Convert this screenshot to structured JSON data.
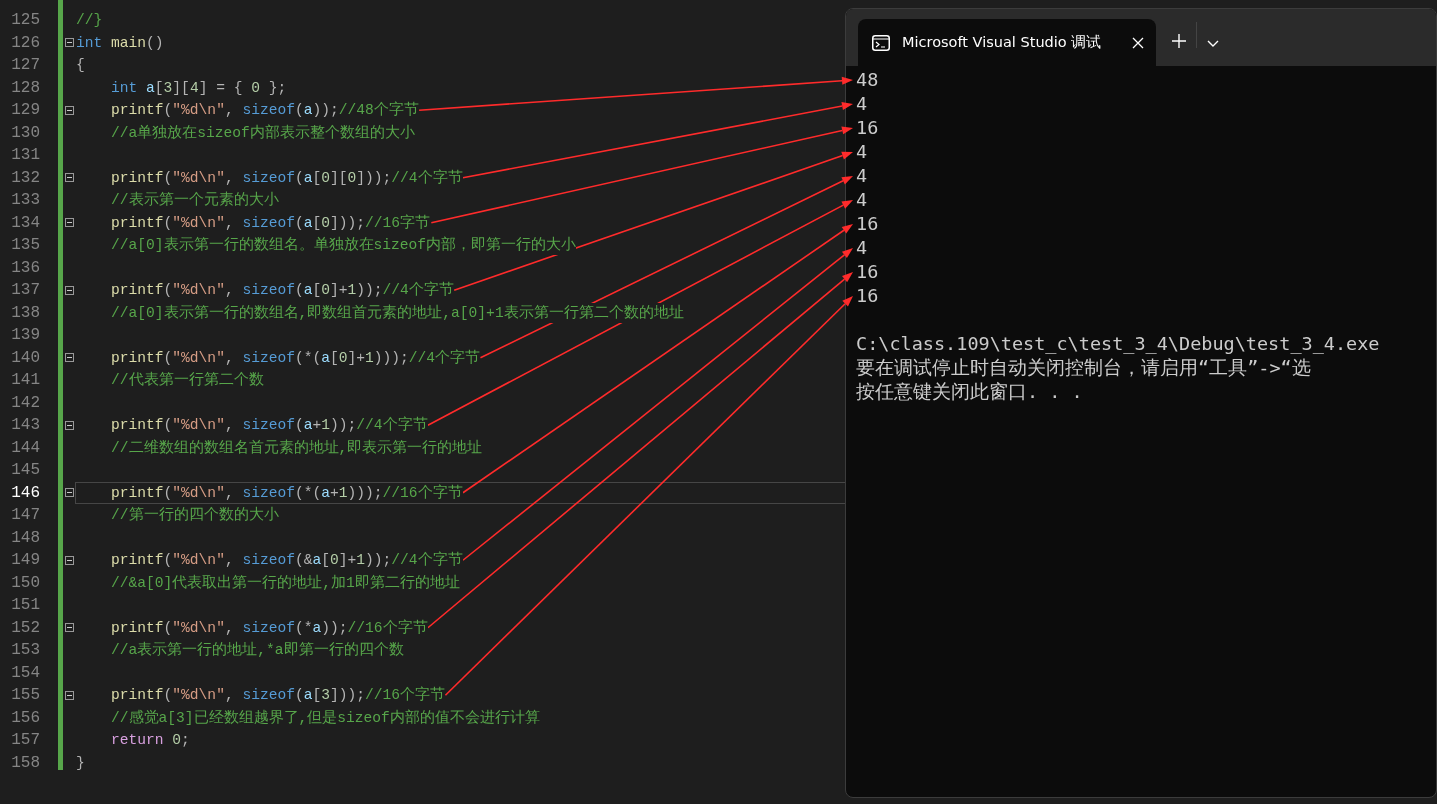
{
  "editor": {
    "lines": [
      {
        "number": "125",
        "fold": false,
        "current": false,
        "annotated": false,
        "tokens": [
          {
            "kind": "com",
            "text": "//}"
          }
        ]
      },
      {
        "number": "126",
        "fold": true,
        "current": false,
        "annotated": false,
        "tokens": [
          {
            "kind": "kw",
            "text": "int"
          },
          {
            "kind": "fn",
            "text": " main"
          },
          {
            "kind": "pun",
            "text": "()"
          }
        ]
      },
      {
        "number": "127",
        "fold": false,
        "current": false,
        "annotated": false,
        "tokens": [
          {
            "kind": "pun",
            "text": "{"
          }
        ]
      },
      {
        "number": "128",
        "fold": false,
        "current": false,
        "annotated": false,
        "tokens": [
          {
            "kind": "kw",
            "text": "    int"
          },
          {
            "kind": "id",
            "text": " a"
          },
          {
            "kind": "pun",
            "text": "["
          },
          {
            "kind": "num",
            "text": "3"
          },
          {
            "kind": "pun",
            "text": "]["
          },
          {
            "kind": "num",
            "text": "4"
          },
          {
            "kind": "pun",
            "text": "] = { "
          },
          {
            "kind": "num",
            "text": "0"
          },
          {
            "kind": "pun",
            "text": " };"
          }
        ]
      },
      {
        "number": "129",
        "fold": true,
        "current": false,
        "annotated": true,
        "tokens": [
          {
            "kind": "fn",
            "text": "    printf"
          },
          {
            "kind": "pun",
            "text": "("
          },
          {
            "kind": "str",
            "text": "\"%d\\n\""
          },
          {
            "kind": "pun",
            "text": ", "
          },
          {
            "kind": "kw",
            "text": "sizeof"
          },
          {
            "kind": "pun",
            "text": "("
          },
          {
            "kind": "id",
            "text": "a"
          },
          {
            "kind": "pun",
            "text": "));"
          },
          {
            "kind": "com",
            "text": "//48个字节"
          }
        ]
      },
      {
        "number": "130",
        "fold": false,
        "current": false,
        "annotated": false,
        "tokens": [
          {
            "kind": "com",
            "text": "    //a单独放在sizeof内部表示整个数组的大小"
          }
        ]
      },
      {
        "number": "131",
        "fold": false,
        "current": false
      },
      {
        "number": "132",
        "fold": true,
        "current": false,
        "annotated": true,
        "tokens": [
          {
            "kind": "fn",
            "text": "    printf"
          },
          {
            "kind": "pun",
            "text": "("
          },
          {
            "kind": "str",
            "text": "\"%d\\n\""
          },
          {
            "kind": "pun",
            "text": ", "
          },
          {
            "kind": "kw",
            "text": "sizeof"
          },
          {
            "kind": "pun",
            "text": "("
          },
          {
            "kind": "id",
            "text": "a"
          },
          {
            "kind": "pun",
            "text": "["
          },
          {
            "kind": "num",
            "text": "0"
          },
          {
            "kind": "pun",
            "text": "]["
          },
          {
            "kind": "num",
            "text": "0"
          },
          {
            "kind": "pun",
            "text": "]));"
          },
          {
            "kind": "com",
            "text": "//4个字节"
          }
        ]
      },
      {
        "number": "133",
        "fold": false,
        "current": false,
        "annotated": false,
        "tokens": [
          {
            "kind": "com",
            "text": "    //表示第一个元素的大小"
          }
        ]
      },
      {
        "number": "134",
        "fold": true,
        "current": false,
        "annotated": true,
        "tokens": [
          {
            "kind": "fn",
            "text": "    printf"
          },
          {
            "kind": "pun",
            "text": "("
          },
          {
            "kind": "str",
            "text": "\"%d\\n\""
          },
          {
            "kind": "pun",
            "text": ", "
          },
          {
            "kind": "kw",
            "text": "sizeof"
          },
          {
            "kind": "pun",
            "text": "("
          },
          {
            "kind": "id",
            "text": "a"
          },
          {
            "kind": "pun",
            "text": "["
          },
          {
            "kind": "num",
            "text": "0"
          },
          {
            "kind": "pun",
            "text": "]));"
          },
          {
            "kind": "com",
            "text": "//16字节"
          }
        ]
      },
      {
        "number": "135",
        "fold": false,
        "current": false,
        "annotated": false,
        "tokens": [
          {
            "kind": "com",
            "text": "    //a[0]表示第一行的数组名。单独放在sizeof内部，即第一行的大小"
          }
        ]
      },
      {
        "number": "136",
        "fold": false,
        "current": false
      },
      {
        "number": "137",
        "fold": true,
        "current": false,
        "annotated": true,
        "tokens": [
          {
            "kind": "fn",
            "text": "    printf"
          },
          {
            "kind": "pun",
            "text": "("
          },
          {
            "kind": "str",
            "text": "\"%d\\n\""
          },
          {
            "kind": "pun",
            "text": ", "
          },
          {
            "kind": "kw",
            "text": "sizeof"
          },
          {
            "kind": "pun",
            "text": "("
          },
          {
            "kind": "id",
            "text": "a"
          },
          {
            "kind": "pun",
            "text": "["
          },
          {
            "kind": "num",
            "text": "0"
          },
          {
            "kind": "pun",
            "text": "]+"
          },
          {
            "kind": "num",
            "text": "1"
          },
          {
            "kind": "pun",
            "text": "));"
          },
          {
            "kind": "com",
            "text": "//4个字节"
          }
        ]
      },
      {
        "number": "138",
        "fold": false,
        "current": false,
        "annotated": false,
        "tokens": [
          {
            "kind": "com",
            "text": "    //a[0]表示第一行的数组名,即数组首元素的地址,a[0]+1表示第一行第二个数的地址"
          }
        ]
      },
      {
        "number": "139",
        "fold": false,
        "current": false
      },
      {
        "number": "140",
        "fold": true,
        "current": false,
        "annotated": true,
        "tokens": [
          {
            "kind": "fn",
            "text": "    printf"
          },
          {
            "kind": "pun",
            "text": "("
          },
          {
            "kind": "str",
            "text": "\"%d\\n\""
          },
          {
            "kind": "pun",
            "text": ", "
          },
          {
            "kind": "kw",
            "text": "sizeof"
          },
          {
            "kind": "pun",
            "text": "(*("
          },
          {
            "kind": "id",
            "text": "a"
          },
          {
            "kind": "pun",
            "text": "["
          },
          {
            "kind": "num",
            "text": "0"
          },
          {
            "kind": "pun",
            "text": "]+"
          },
          {
            "kind": "num",
            "text": "1"
          },
          {
            "kind": "pun",
            "text": ")));"
          },
          {
            "kind": "com",
            "text": "//4个字节"
          }
        ]
      },
      {
        "number": "141",
        "fold": false,
        "current": false,
        "annotated": false,
        "tokens": [
          {
            "kind": "com",
            "text": "    //代表第一行第二个数"
          }
        ]
      },
      {
        "number": "142",
        "fold": false,
        "current": false
      },
      {
        "number": "143",
        "fold": true,
        "current": false,
        "annotated": true,
        "tokens": [
          {
            "kind": "fn",
            "text": "    printf"
          },
          {
            "kind": "pun",
            "text": "("
          },
          {
            "kind": "str",
            "text": "\"%d\\n\""
          },
          {
            "kind": "pun",
            "text": ", "
          },
          {
            "kind": "kw",
            "text": "sizeof"
          },
          {
            "kind": "pun",
            "text": "("
          },
          {
            "kind": "id",
            "text": "a"
          },
          {
            "kind": "pun",
            "text": "+"
          },
          {
            "kind": "num",
            "text": "1"
          },
          {
            "kind": "pun",
            "text": "));"
          },
          {
            "kind": "com",
            "text": "//4个字节"
          }
        ]
      },
      {
        "number": "144",
        "fold": false,
        "current": false,
        "annotated": false,
        "tokens": [
          {
            "kind": "com",
            "text": "    //二维数组的数组名首元素的地址,即表示第一行的地址"
          }
        ]
      },
      {
        "number": "145",
        "fold": false,
        "current": false
      },
      {
        "number": "146",
        "fold": true,
        "current": true,
        "annotated": true,
        "tokens": [
          {
            "kind": "fn",
            "text": "    printf"
          },
          {
            "kind": "pun",
            "text": "("
          },
          {
            "kind": "str",
            "text": "\"%d\\n\""
          },
          {
            "kind": "pun",
            "text": ", "
          },
          {
            "kind": "kw",
            "text": "sizeof"
          },
          {
            "kind": "pun",
            "text": "(*("
          },
          {
            "kind": "id",
            "text": "a"
          },
          {
            "kind": "pun",
            "text": "+"
          },
          {
            "kind": "num",
            "text": "1"
          },
          {
            "kind": "pun",
            "text": ")));"
          },
          {
            "kind": "com",
            "text": "//16个字节"
          }
        ]
      },
      {
        "number": "147",
        "fold": false,
        "current": false,
        "annotated": false,
        "tokens": [
          {
            "kind": "com",
            "text": "    //第一行的四个数的大小"
          }
        ]
      },
      {
        "number": "148",
        "fold": false,
        "current": false
      },
      {
        "number": "149",
        "fold": true,
        "current": false,
        "annotated": true,
        "tokens": [
          {
            "kind": "fn",
            "text": "    printf"
          },
          {
            "kind": "pun",
            "text": "("
          },
          {
            "kind": "str",
            "text": "\"%d\\n\""
          },
          {
            "kind": "pun",
            "text": ", "
          },
          {
            "kind": "kw",
            "text": "sizeof"
          },
          {
            "kind": "pun",
            "text": "(&"
          },
          {
            "kind": "id",
            "text": "a"
          },
          {
            "kind": "pun",
            "text": "["
          },
          {
            "kind": "num",
            "text": "0"
          },
          {
            "kind": "pun",
            "text": "]+"
          },
          {
            "kind": "num",
            "text": "1"
          },
          {
            "kind": "pun",
            "text": "));"
          },
          {
            "kind": "com",
            "text": "//4个字节"
          }
        ]
      },
      {
        "number": "150",
        "fold": false,
        "current": false,
        "annotated": false,
        "tokens": [
          {
            "kind": "com",
            "text": "    //&a[0]代表取出第一行的地址,加1即第二行的地址"
          }
        ]
      },
      {
        "number": "151",
        "fold": false,
        "current": false
      },
      {
        "number": "152",
        "fold": true,
        "current": false,
        "annotated": true,
        "tokens": [
          {
            "kind": "fn",
            "text": "    printf"
          },
          {
            "kind": "pun",
            "text": "("
          },
          {
            "kind": "str",
            "text": "\"%d\\n\""
          },
          {
            "kind": "pun",
            "text": ", "
          },
          {
            "kind": "kw",
            "text": "sizeof"
          },
          {
            "kind": "pun",
            "text": "(*"
          },
          {
            "kind": "id",
            "text": "a"
          },
          {
            "kind": "pun",
            "text": "));"
          },
          {
            "kind": "com",
            "text": "//16个字节"
          }
        ]
      },
      {
        "number": "153",
        "fold": false,
        "current": false,
        "annotated": false,
        "tokens": [
          {
            "kind": "com",
            "text": "    //a表示第一行的地址,*a即第一行的四个数"
          }
        ]
      },
      {
        "number": "154",
        "fold": false,
        "current": false
      },
      {
        "number": "155",
        "fold": true,
        "current": false,
        "annotated": true,
        "tokens": [
          {
            "kind": "fn",
            "text": "    printf"
          },
          {
            "kind": "pun",
            "text": "("
          },
          {
            "kind": "str",
            "text": "\"%d\\n\""
          },
          {
            "kind": "pun",
            "text": ", "
          },
          {
            "kind": "kw",
            "text": "sizeof"
          },
          {
            "kind": "pun",
            "text": "("
          },
          {
            "kind": "id",
            "text": "a"
          },
          {
            "kind": "pun",
            "text": "["
          },
          {
            "kind": "num",
            "text": "3"
          },
          {
            "kind": "pun",
            "text": "]));"
          },
          {
            "kind": "com",
            "text": "//16个字节"
          }
        ]
      },
      {
        "number": "156",
        "fold": false,
        "current": false,
        "annotated": false,
        "tokens": [
          {
            "kind": "com",
            "text": "    //感觉a[3]已经数组越界了,但是sizeof内部的值不会进行计算"
          }
        ]
      },
      {
        "number": "157",
        "fold": false,
        "current": false,
        "annotated": false,
        "tokens": [
          {
            "kind": "ctl",
            "text": "    return"
          },
          {
            "kind": "num",
            "text": " 0"
          },
          {
            "kind": "pun",
            "text": ";"
          }
        ]
      },
      {
        "number": "158",
        "fold": false,
        "current": false,
        "annotated": false,
        "tokens": [
          {
            "kind": "pun",
            "text": "}"
          }
        ]
      }
    ]
  },
  "console": {
    "tab": {
      "title": "Microsoft Visual Studio 调试",
      "selected": true
    },
    "output": [
      "48",
      "4",
      "16",
      "4",
      "4",
      "4",
      "16",
      "4",
      "16",
      "16"
    ],
    "messages": [
      "C:\\class.109\\test_c\\test_3_4\\Debug\\test_3_4.exe",
      "要在调试停止时自动关闭控制台，请启用“工具”->“选",
      "按任意键关闭此窗口. . ."
    ]
  }
}
